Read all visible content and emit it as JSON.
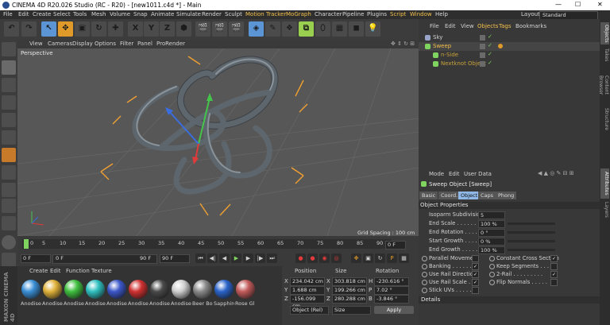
{
  "window": {
    "title": "CINEMA 4D R20.026 Studio (RC - R20) - [new1011.c4d *] - Main",
    "controls": [
      "—",
      "☐",
      "✕"
    ]
  },
  "menubar": {
    "items": [
      "File",
      "Edit",
      "Create",
      "Select",
      "Tools",
      "Mesh",
      "Volume",
      "Snap",
      "Animate",
      "Simulate",
      "Render",
      "Sculpt",
      "Motion Tracker",
      "MoGraph",
      "Character",
      "Pipeline",
      "Plugins",
      "Script",
      "Window",
      "Help"
    ],
    "layout_label": "Layout:",
    "layout_value": "Standard"
  },
  "toolbar": {
    "axis_buttons": [
      "X",
      "Y",
      "Z"
    ]
  },
  "viewport": {
    "menu": [
      "View",
      "Cameras",
      "Display",
      "Options",
      "Filter",
      "Panel",
      "ProRender"
    ],
    "label": "Perspective",
    "grid_spacing": "Grid Spacing : 100 cm",
    "axis_colors": {
      "x": "#e03a3a",
      "y": "#45c44a",
      "z": "#3a6ee0"
    }
  },
  "timeline": {
    "ticks": [
      "0",
      "5",
      "10",
      "15",
      "20",
      "25",
      "30",
      "35",
      "40",
      "45",
      "50",
      "55",
      "60",
      "65",
      "70",
      "75",
      "80",
      "85",
      "90"
    ],
    "current_frame": "0 F",
    "start_frame": "0 F",
    "range_start": "0 F",
    "range_end": "90 F",
    "end_frame": "90 F"
  },
  "materials": {
    "menu": [
      "Create",
      "Edit",
      "Function",
      "Texture"
    ],
    "items": [
      {
        "label": "Anodise",
        "color": "#3b8fd6"
      },
      {
        "label": "Anodise",
        "color": "#e0b23a"
      },
      {
        "label": "Anodise",
        "color": "#3fbf3f"
      },
      {
        "label": "Anodise",
        "color": "#2fbfbf"
      },
      {
        "label": "Anodise",
        "color": "#3b57c9"
      },
      {
        "label": "Anodise",
        "color": "#d03030"
      },
      {
        "label": "Anodise",
        "color": "#4a4a4a"
      },
      {
        "label": "Anodise",
        "color": "#cfcfcf"
      },
      {
        "label": "Beer Bo",
        "color": "#8a8a8a"
      },
      {
        "label": "Sapphire",
        "color": "#2a63c9"
      },
      {
        "label": "Rose Gl",
        "color": "#c25a5a"
      }
    ]
  },
  "coordinates": {
    "headers": [
      "Position",
      "Size",
      "Rotation"
    ],
    "rows": [
      {
        "pos_axis": "X",
        "pos": "234.042 cm",
        "size_axis": "X",
        "size": "303.818 cm",
        "rot_axis": "H",
        "rot": "-230.616 °"
      },
      {
        "pos_axis": "Y",
        "pos": "1.688 cm",
        "size_axis": "Y",
        "size": "199.266 cm",
        "rot_axis": "P",
        "rot": "7.02 °"
      },
      {
        "pos_axis": "Z",
        "pos": "-156.099 cm",
        "size_axis": "Z",
        "size": "280.288 cm",
        "rot_axis": "B",
        "rot": "-3.846 °"
      }
    ],
    "mode": "Object (Rel)",
    "size_mode": "Size",
    "apply": "Apply"
  },
  "objects": {
    "menu": [
      "File",
      "Edit",
      "View",
      "Objects",
      "Tags",
      "Bookmarks"
    ],
    "items": [
      {
        "name": "Sky",
        "color": "#d2d2d2",
        "indent": 0
      },
      {
        "name": "Sweep",
        "color": "#f3c04b",
        "indent": 0
      },
      {
        "name": "n-Side",
        "color": "#c8a23a",
        "indent": 1
      },
      {
        "name": "Nextknot Object",
        "color": "#c8a23a",
        "indent": 1
      }
    ]
  },
  "attributes": {
    "menu": [
      "Mode",
      "Edit",
      "User Data"
    ],
    "object_title": "Sweep Object [Sweep]",
    "tabs": [
      "Basic",
      "Coord.",
      "Object",
      "Caps",
      "Phong"
    ],
    "active_tab": "Object",
    "section": "Object Properties",
    "props": [
      {
        "label": "Isoparm Subdivision",
        "value": "5"
      },
      {
        "label": "End Scale . . . . . .",
        "value": "100 %"
      },
      {
        "label": "End Rotation . . . . .",
        "value": "0 °"
      },
      {
        "label": "Start Growth . . . . .",
        "value": "0 %"
      },
      {
        "label": "End Growth . . . . .",
        "value": "100 %"
      }
    ],
    "checks_left": [
      {
        "label": "Parallel Movement",
        "checked": false
      },
      {
        "label": "Banking . . . . . . .",
        "checked": true
      },
      {
        "label": "Use Rail Direction",
        "checked": true
      },
      {
        "label": "Use Rail Scale . . .",
        "checked": true
      },
      {
        "label": "Stick UVs . . . . . .",
        "checked": false
      }
    ],
    "checks_right": [
      {
        "label": "Constant Cross Section",
        "checked": true
      },
      {
        "label": "Keep Segments . . . .",
        "checked": false
      },
      {
        "label": "2-Rail . . . . . . . . .",
        "checked": true
      },
      {
        "label": "Flip Normals . . . . .",
        "checked": false
      }
    ],
    "details": "Details"
  },
  "side_tabs": [
    "Objects",
    "Takes",
    "Content Browser",
    "Structure",
    "Attributes",
    "Layers"
  ],
  "logo": "MAXON CINEMA 4D"
}
